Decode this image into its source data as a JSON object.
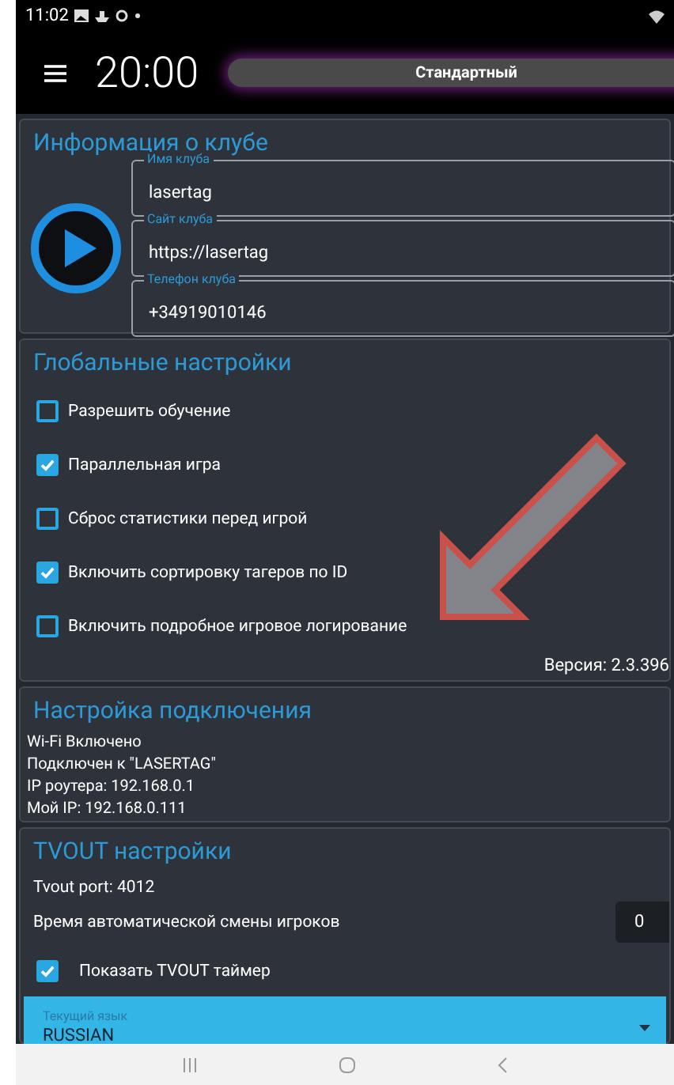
{
  "status_bar": {
    "time": "11:02"
  },
  "top_bar": {
    "timer": "20:00",
    "mode": "Стандартный"
  },
  "club_info": {
    "title": "Информация о клубе",
    "fields": [
      {
        "label": "Имя клуба",
        "value": "lasertag"
      },
      {
        "label": "Сайт клуба",
        "value": "https://lasertag"
      },
      {
        "label": "Телефон клуба",
        "value": "+34919010146"
      }
    ]
  },
  "global_settings": {
    "title": "Глобальные настройки",
    "options": [
      {
        "label": "Разрешить обучение",
        "checked": false
      },
      {
        "label": "Параллельная игра",
        "checked": true
      },
      {
        "label": "Сброс статистики перед игрой",
        "checked": false
      },
      {
        "label": "Включить сортировку тагеров по ID",
        "checked": true
      },
      {
        "label": "Включить подробное игровое логирование",
        "checked": false
      }
    ],
    "version": "Версия: 2.3.396"
  },
  "connection": {
    "title": "Настройка подключения",
    "lines": [
      "Wi-Fi Включено",
      "Подключен к \"LASERTAG\"",
      "IP роутера: 192.168.0.1",
      "Мой IP: 192.168.0.111"
    ]
  },
  "tvout": {
    "title": "TVOUT настройки",
    "port": "Tvout port: 4012",
    "auto_switch": {
      "label": "Время автоматической смены игроков",
      "value": "0"
    },
    "show_timer": {
      "label": "Показать TVOUT таймер",
      "checked": true
    },
    "language": {
      "label": "Текущий язык",
      "value": "RUSSIAN"
    }
  }
}
